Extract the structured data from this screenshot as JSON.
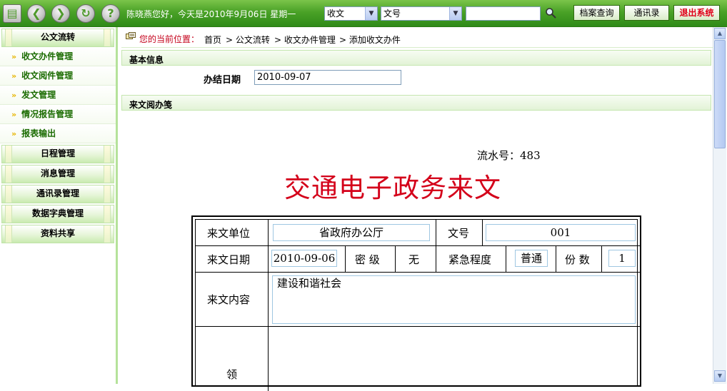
{
  "topbar": {
    "icons": [
      "document-icon",
      "back-arrow-icon",
      "forward-arrow-icon",
      "refresh-icon",
      "help-icon"
    ],
    "greeting": "陈晓燕您好，今天是2010年9月06日 星期一",
    "select_type": "收文",
    "select_field": "文号",
    "search_value": "",
    "buttons": {
      "archive": "档案查询",
      "contacts": "通讯录",
      "exit": "退出系统"
    }
  },
  "sidebar": {
    "sections": [
      {
        "title": "公文流转",
        "items": [
          "收文办件管理",
          "收文阅件管理",
          "发文管理",
          "情况报告管理",
          "报表输出"
        ]
      },
      {
        "title": "日程管理",
        "items": []
      },
      {
        "title": "消息管理",
        "items": []
      },
      {
        "title": "通讯录管理",
        "items": []
      },
      {
        "title": "数据字典管理",
        "items": []
      },
      {
        "title": "资料共享",
        "items": []
      }
    ]
  },
  "breadcrumb": {
    "label": "您的当前位置：",
    "items": [
      "首页",
      "> 公文流转",
      "> 收文办件管理",
      "> 添加收文办件"
    ]
  },
  "basic_info": {
    "title": "基本信息",
    "finish_date_label": "办结日期",
    "finish_date_value": "2010-09-07"
  },
  "receipt_form": {
    "section_title": "来文阅办笺",
    "serial": "流水号：483",
    "doc_title": "交通电子政务来文",
    "fields": {
      "sender_label": "来文单位",
      "sender_value": "省政府办公厅",
      "docno_label": "文号",
      "docno_value": "001",
      "date_label": "来文日期",
      "date_value": "2010-09-06",
      "secret_label": "密 级",
      "secret_value": "无",
      "urgency_label": "紧急程度",
      "urgency_value": "普通",
      "copies_label": "份 数",
      "copies_value": "1",
      "content_label": "来文内容",
      "content_value": "建设和谐社会",
      "leader_label": "领"
    }
  },
  "colors": {
    "topbar": "#4aa227",
    "nav_text": "#1a6b00",
    "title_red": "#d4001a",
    "crumb_red": "#c4001a"
  }
}
